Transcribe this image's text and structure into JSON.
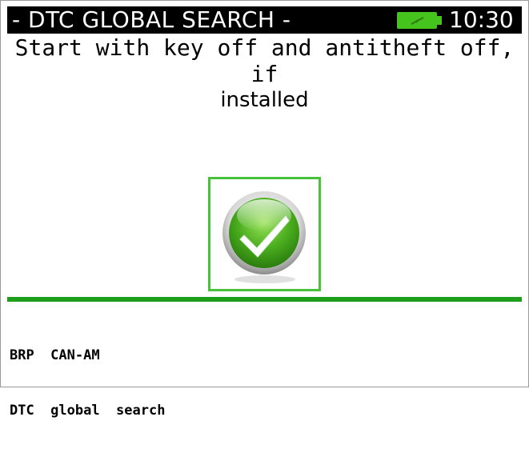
{
  "header": {
    "title": "- DTC GLOBAL SEARCH -",
    "time": "10:30",
    "battery_icon": "battery-charging-icon",
    "battery_color": "#45c41d"
  },
  "main": {
    "instruction_line1": "Start with key off and antitheft off, if",
    "instruction_line2": "installed",
    "confirm_icon": "checkmark-icon",
    "accent_color": "#1f9e1c"
  },
  "footer": {
    "line1": "BRP  CAN-AM",
    "line2": "DTC  global  search"
  }
}
